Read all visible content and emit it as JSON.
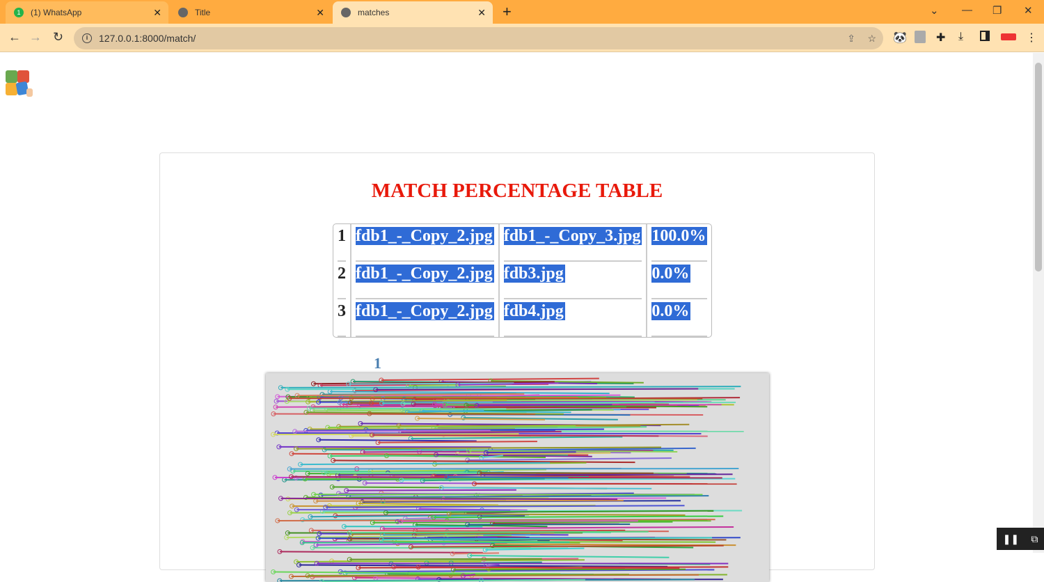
{
  "browser": {
    "tabs": [
      {
        "label": "(1) WhatsApp",
        "badge": "1"
      },
      {
        "label": "Title"
      },
      {
        "label": "matches",
        "active": true
      }
    ],
    "url": "127.0.0.1:8000/match/"
  },
  "page": {
    "title": "MATCH PERCENTAGE TABLE",
    "rows": [
      {
        "index": "1",
        "file_a": "fdb1_-_Copy_2.jpg",
        "file_b": "fdb1_-_Copy_3.jpg",
        "percent": "100.0%"
      },
      {
        "index": "2",
        "file_a": "fdb1_-_Copy_2.jpg",
        "file_b": "fdb3.jpg",
        "percent": "0.0%"
      },
      {
        "index": "3",
        "file_a": "fdb1_-_Copy_2.jpg",
        "file_b": "fdb4.jpg",
        "percent": "0.0%"
      }
    ],
    "image_label": "1"
  },
  "colors": {
    "title": "#e8190b",
    "selection": "#2f6bd6",
    "chrome": "#ffab40"
  }
}
